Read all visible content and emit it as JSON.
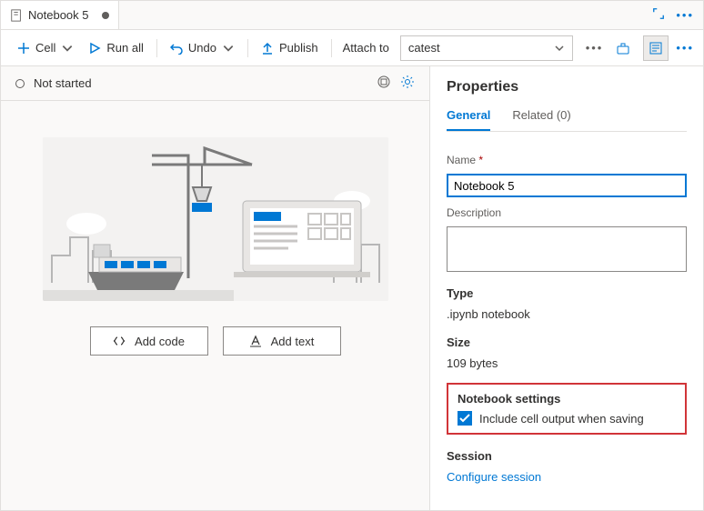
{
  "tab": {
    "title": "Notebook 5",
    "dirty": true
  },
  "toolbar": {
    "cell_label": "Cell",
    "run_all_label": "Run all",
    "undo_label": "Undo",
    "publish_label": "Publish",
    "attach_label": "Attach to",
    "attach_value": "catest"
  },
  "status": {
    "state": "Not started"
  },
  "canvas": {
    "add_code_label": "Add code",
    "add_text_label": "Add text"
  },
  "properties": {
    "title": "Properties",
    "tabs": {
      "general": "General",
      "related": "Related (0)"
    },
    "name_label": "Name",
    "name_value": "Notebook 5",
    "description_label": "Description",
    "description_value": "",
    "type_label": "Type",
    "type_value": ".ipynb notebook",
    "size_label": "Size",
    "size_value": "109 bytes",
    "nb_settings_label": "Notebook settings",
    "include_cell_output_label": "Include cell output when saving",
    "include_cell_output_checked": true,
    "session_label": "Session",
    "configure_session_label": "Configure session"
  }
}
